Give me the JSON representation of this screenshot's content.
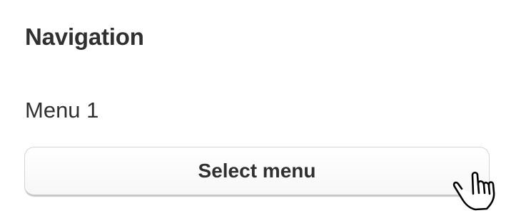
{
  "navigation": {
    "heading": "Navigation",
    "menu_label": "Menu 1",
    "select_button_label": "Select menu"
  },
  "cursor": {
    "icon": "hand-pointer-cursor-icon"
  },
  "colors": {
    "text": "#303030",
    "button_border": "#d4d4d4",
    "button_background": "#ffffff"
  }
}
